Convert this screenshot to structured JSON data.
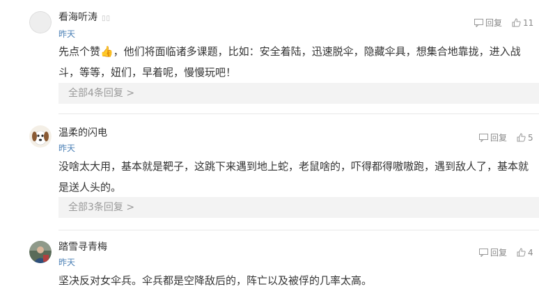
{
  "comments": [
    {
      "username": "看海听涛",
      "badge": "▯▯",
      "time": "昨天",
      "reply_label": "回复",
      "like_count": "11",
      "text": "先点个赞👍，他们将面临诸多课题，比如：安全着陆，迅速脱伞，隐藏伞具，想集合地靠拢，进入战斗，等等，妞们，早着呢，慢慢玩吧！",
      "more_replies": "全部4条回复 >"
    },
    {
      "username": "温柔的闪电",
      "time": "昨天",
      "reply_label": "回复",
      "like_count": "5",
      "text": "没啥太大用，基本就是靶子，这跳下来遇到地上蛇，老鼠啥的，吓得都得嗷嗷跑，遇到敌人了，基本就是送人头的。",
      "more_replies": "全部3条回复 >"
    },
    {
      "username": "踏雪寻青梅",
      "time": "昨天",
      "reply_label": "回复",
      "like_count": "4",
      "text": "坚决反对女伞兵。伞兵都是空降敌后的，阵亡以及被俘的几率太高。"
    }
  ],
  "colors": {
    "time": "#4a7fb5",
    "reply_bar": "#f3f3f3",
    "action": "#888888"
  },
  "icons": [
    "reply-icon",
    "thumbs-up-icon",
    "dog-avatar",
    "photo-avatar",
    "default-avatar"
  ]
}
